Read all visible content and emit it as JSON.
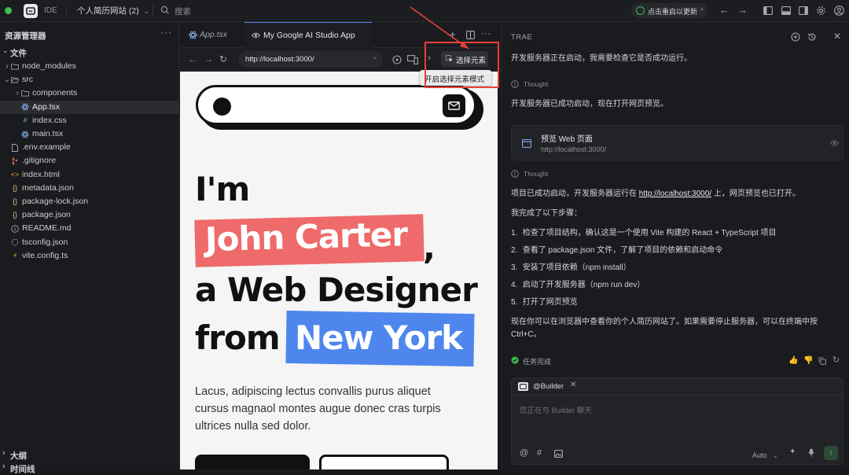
{
  "topbar": {
    "logo_label": "IDE",
    "project_name": "个人简历网站 (2)",
    "search_placeholder": "搜索",
    "restart_label": "点击重启以更新"
  },
  "sidebar": {
    "title": "资源管理器",
    "section_files": "文件",
    "tree": [
      {
        "label": "node_modules",
        "kind": "folder",
        "depth": 1,
        "chevron": "›"
      },
      {
        "label": "src",
        "kind": "folder-open",
        "depth": 1,
        "chevron": "⌄"
      },
      {
        "label": "components",
        "kind": "folder",
        "depth": 2,
        "chevron": "›"
      },
      {
        "label": "App.tsx",
        "kind": "react",
        "depth": 2,
        "active": true
      },
      {
        "label": "index.css",
        "kind": "css",
        "depth": 2
      },
      {
        "label": "main.tsx",
        "kind": "react",
        "depth": 2
      },
      {
        "label": ".env.example",
        "kind": "file",
        "depth": 1
      },
      {
        "label": ".gitignore",
        "kind": "git",
        "depth": 1
      },
      {
        "label": "index.html",
        "kind": "html",
        "depth": 1
      },
      {
        "label": "metadata.json",
        "kind": "json",
        "depth": 1
      },
      {
        "label": "package-lock.json",
        "kind": "json",
        "depth": 1
      },
      {
        "label": "package.json",
        "kind": "json",
        "depth": 1
      },
      {
        "label": "README.md",
        "kind": "info",
        "depth": 1
      },
      {
        "label": "tsconfig.json",
        "kind": "tsconfig",
        "depth": 1
      },
      {
        "label": "vite.config.ts",
        "kind": "vite",
        "depth": 1
      }
    ],
    "section_outline": "大纲",
    "section_timeline": "时间线"
  },
  "editor": {
    "tabs": [
      {
        "label": "App.tsx",
        "active": false
      },
      {
        "label": "My Google AI Studio App",
        "active": true
      }
    ],
    "url": "http://localhost:3000/",
    "select_element_label": "选择元素",
    "tooltip": "开启选择元素模式"
  },
  "preview": {
    "line1": "I'm",
    "name": "John Carter",
    "comma": ",",
    "line3": "a Web Designer",
    "from": "from",
    "city": "New York",
    "paragraph_lines": [
      "Lacus, adipiscing lectus convallis purus aliquet",
      "cursus magnaol montes augue donec cras turpis",
      "ultrices nulla sed dolor."
    ],
    "colors": {
      "name_bg": "#ef6a6a",
      "city_bg": "#4e86ee"
    }
  },
  "chat": {
    "title": "TRAE",
    "msg1": "开发服务器正在启动，我需要检查它是否成功运行。",
    "thought1": "Thought",
    "msg2": "开发服务器已成功启动，现在打开网页预览。",
    "card_title": "预览 Web 页面",
    "card_url": "http://localhost:3000/",
    "thought2": "Thought",
    "msg3_pre": "项目已成功启动，开发服务器运行在 ",
    "msg3_link": "http://localhost:3000/",
    "msg3_post": " 上，网页预览也已打开。",
    "msg4": "我完成了以下步骤：",
    "steps": [
      {
        "n": "1.",
        "text": "检查了项目结构，确认这是一个使用 Vite 构建的 React + TypeScript 项目"
      },
      {
        "n": "2.",
        "text": "查看了 package.json 文件，了解了项目的依赖和启动命令"
      },
      {
        "n": "3.",
        "text": "安装了项目依赖（npm install）"
      },
      {
        "n": "4.",
        "text": "启动了开发服务器（npm run dev）"
      },
      {
        "n": "5.",
        "text": "打开了网页预览"
      }
    ],
    "msg5_line1": "现在你可以在浏览器中查看你的个人简历网站了。如果需要停止服务器，可以在终端中按",
    "msg5_line2": "Ctrl+C。",
    "task_done": "任务完成",
    "builder": "@Builder",
    "input_placeholder": "您正在与 Builder 聊天",
    "mode": "Auto"
  }
}
